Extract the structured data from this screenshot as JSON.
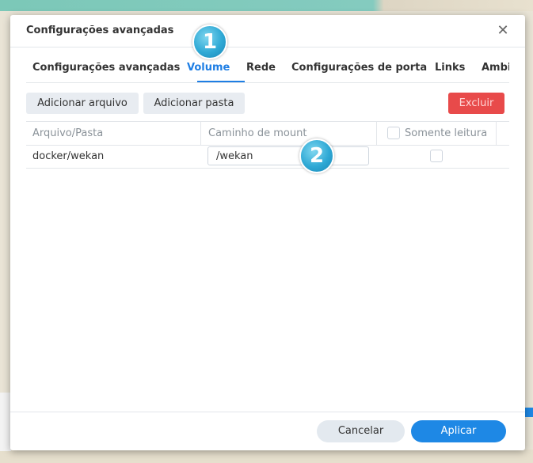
{
  "dialog": {
    "title": "Configurações avançadas",
    "close_glyph": "✕"
  },
  "tabs": [
    {
      "label": "Configurações avançadas"
    },
    {
      "label": "Volume"
    },
    {
      "label": "Rede"
    },
    {
      "label": "Configurações de porta"
    },
    {
      "label": "Links"
    },
    {
      "label": "Ambi"
    }
  ],
  "active_tab": "Volume",
  "toolbar": {
    "add_file_label": "Adicionar arquivo",
    "add_folder_label": "Adicionar pasta",
    "delete_label": "Excluir"
  },
  "table": {
    "headers": [
      "Arquivo/Pasta",
      "Caminho de mount",
      "Somente leitura"
    ],
    "rows": [
      {
        "path": "docker/wekan",
        "mount": "/wekan",
        "read_only": false
      }
    ]
  },
  "footer": {
    "cancel_label": "Cancelar",
    "apply_label": "Aplicar"
  },
  "markers": [
    "1",
    "2"
  ],
  "colors": {
    "accent": "#1e88e5",
    "active_tab": "#1e7ee4",
    "danger": "#e84a4a"
  }
}
